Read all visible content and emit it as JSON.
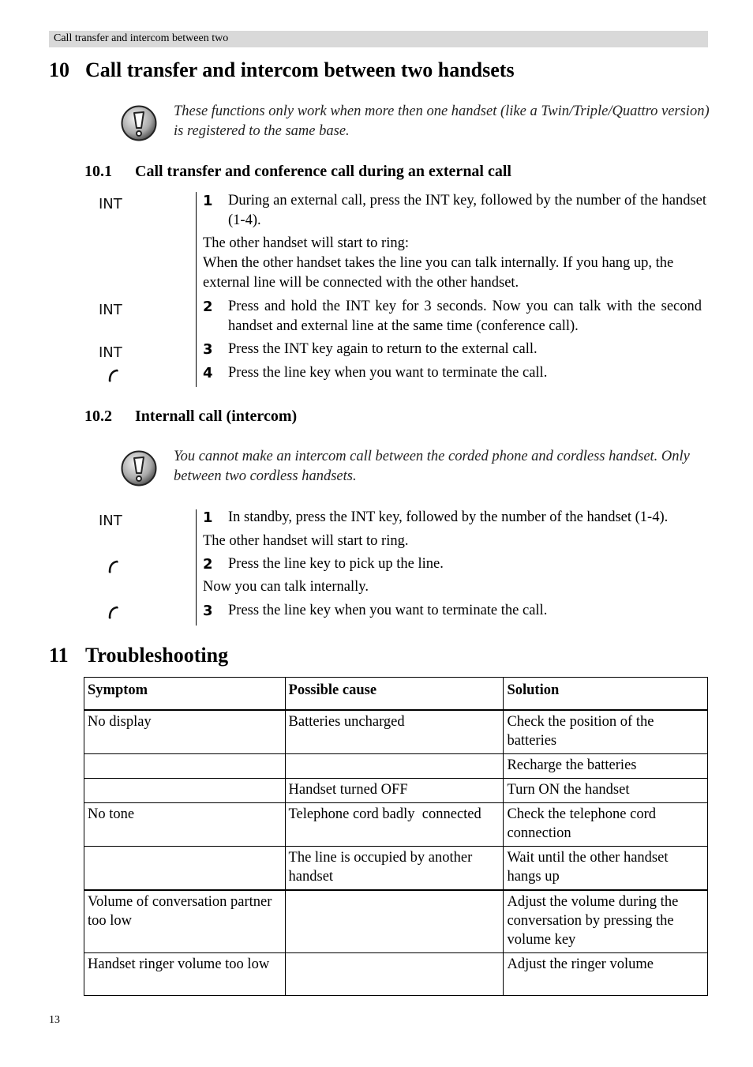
{
  "running_header": "Call transfer and intercom between two",
  "section10": {
    "number": "10",
    "title": "Call transfer and intercom between two handsets",
    "note": "These functions only work when more then one handset (like a Twin/Triple/Quattro version) is registered to the same base.",
    "note_icon": "exclamation-warning-icon",
    "sub1": {
      "number": "10.1",
      "title": "Call transfer and conference call during an external call",
      "keys": [
        "INT",
        "INT",
        "INT"
      ],
      "steps": [
        {
          "n": "1",
          "text": "During an external call, press the INT key, followed by the number of the handset (1-4)."
        },
        {
          "n": "2",
          "text": "Press and hold the INT key for 3 seconds. Now you can talk with the second handset and external line at the same time (conference call)."
        },
        {
          "n": "3",
          "text": "Press the INT key again to return to the external call."
        },
        {
          "n": "4",
          "text": "Press the line key when you want to terminate the call."
        }
      ],
      "para1": "The other handset will start to ring:",
      "para2": "When the other handset takes the line you can talk internally. If you hang up, the external line will be connected with the other handset."
    },
    "sub2": {
      "number": "10.2",
      "title": "Internall call (intercom)",
      "note": "You cannot make an intercom call between the corded phone and cordless handset. Only between two cordless handsets.",
      "keys": [
        "INT"
      ],
      "steps": [
        {
          "n": "1",
          "text": "In standby, press the INT key, followed by the number of the handset (1-4)."
        },
        {
          "n": "2",
          "text": "Press the line key to pick up the line."
        },
        {
          "n": "3",
          "text": "Press the line key when you want to terminate the call."
        }
      ],
      "para1": "The other handset will start to ring.",
      "para2": "Now you can talk internally."
    }
  },
  "section11": {
    "number": "11",
    "title": "Troubleshooting",
    "table": {
      "headers": [
        "Symptom",
        "Possible cause",
        "Solution"
      ],
      "rows": [
        [
          "No display",
          "Batteries uncharged",
          "Check the position of the batteries"
        ],
        [
          "",
          "",
          "Recharge the batteries"
        ],
        [
          "",
          "Handset turned OFF",
          "Turn ON the handset"
        ],
        [
          "No tone",
          "Telephone cord badly  connected",
          "Check the telephone cord connection"
        ],
        [
          "",
          "The line is occupied by another handset",
          "Wait until the other handset hangs up"
        ],
        [
          "Volume of conversation partner too low",
          "",
          "Adjust the volume during the conversation by pressing the volume key"
        ],
        [
          "Handset ringer volume too low",
          "",
          "Adjust the ringer volume"
        ]
      ]
    }
  },
  "page_number": "13"
}
